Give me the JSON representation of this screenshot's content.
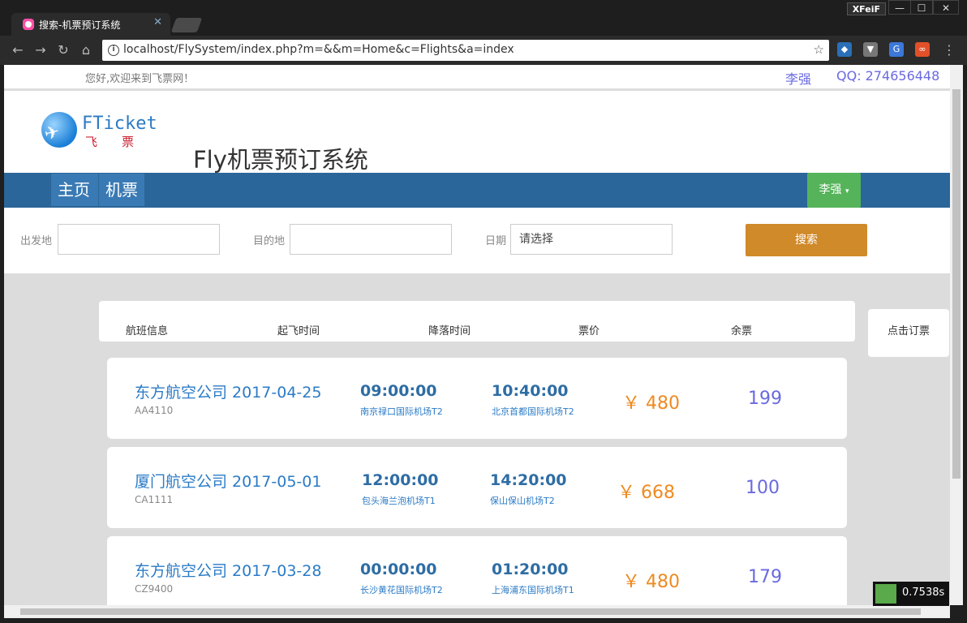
{
  "browser": {
    "tab_title": "搜索-机票预订系统",
    "url": "localhost/FlySystem/index.php?m=&&m=Home&c=Flights&a=index",
    "user_chip": "XFeiF"
  },
  "topbar": {
    "welcome": "您好,欢迎来到飞票网！",
    "user": "李强",
    "qq": "QQ: 274656448"
  },
  "header": {
    "logo_text": "FTicket",
    "logo_sub": "飞票",
    "title": "Fly机票预订系统"
  },
  "nav": {
    "items": [
      "主页",
      "机票"
    ],
    "user_menu": "李强"
  },
  "search": {
    "from_label": "出发地",
    "from_value": "",
    "to_label": "目的地",
    "to_value": "",
    "date_label": "日期",
    "date_placeholder": "请选择",
    "button": "搜索"
  },
  "columns": [
    "航班信息",
    "起飞时间",
    "降落时间",
    "票价",
    "余票"
  ],
  "book_button": "点击订票",
  "flights": [
    {
      "airline": "东方航空公司 2017-04-25",
      "number": "AA4110",
      "dep_time": "09:00:00",
      "dep_airport": "南京禄口国际机场T2",
      "arr_time": "10:40:00",
      "arr_airport": "北京首都国际机场T2",
      "price": "￥ 480",
      "seats": "199"
    },
    {
      "airline": "厦门航空公司 2017-05-01",
      "number": "CA1111",
      "dep_time": "12:00:00",
      "dep_airport": "包头海兰泡机场T1",
      "arr_time": "14:20:00",
      "arr_airport": "保山保山机场T2",
      "price": "￥ 668",
      "seats": "100"
    },
    {
      "airline": "东方航空公司 2017-03-28",
      "number": "CZ9400",
      "dep_time": "00:00:00",
      "dep_airport": "长沙黄花国际机场T2",
      "arr_time": "01:20:00",
      "arr_airport": "上海浦东国际机场T1",
      "price": "￥ 480",
      "seats": "179"
    }
  ],
  "timer": "0.7538s"
}
